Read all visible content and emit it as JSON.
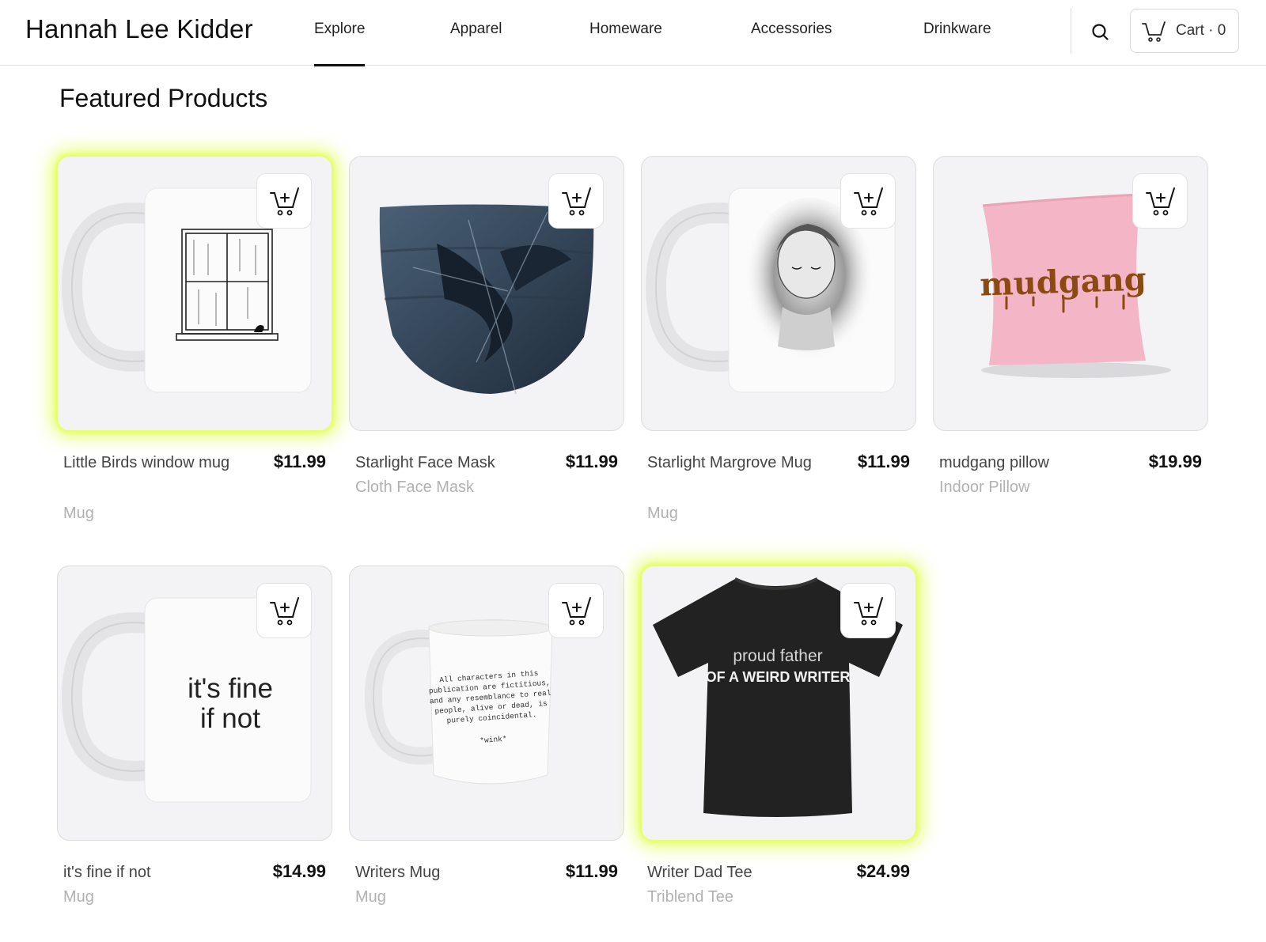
{
  "brand": {
    "name": "Hannah Lee Kidder"
  },
  "nav": {
    "items": [
      {
        "label": "Explore",
        "active": true
      },
      {
        "label": "Apparel",
        "active": false
      },
      {
        "label": "Homeware",
        "active": false
      },
      {
        "label": "Accessories",
        "active": false
      },
      {
        "label": "Drinkware",
        "active": false
      }
    ]
  },
  "header": {
    "search_icon": "search-icon",
    "cart_icon": "cart-icon",
    "cart_label": "Cart · 0"
  },
  "section": {
    "title": "Featured Products"
  },
  "colors": {
    "highlight_glow": "#d8ff1e",
    "card_bg": "#f3f3f5",
    "muted_text": "#b1b1b1"
  },
  "products": [
    {
      "name": "Little Birds window mug",
      "price": "$11.99",
      "type": "Mug",
      "highlighted": true,
      "image": "white mug with window and bird drawing"
    },
    {
      "name": "Starlight Face Mask",
      "price": "$11.99",
      "type": "Cloth Face Mask",
      "highlighted": false,
      "image": "dark blue face mask with crow"
    },
    {
      "name": "Starlight Margrove Mug",
      "price": "$11.99",
      "type": "Mug",
      "highlighted": false,
      "image": "white mug with woman portrait"
    },
    {
      "name": "mudgang pillow",
      "price": "$19.99",
      "type": "Indoor Pillow",
      "highlighted": false,
      "image": "pink pillow",
      "print_text": "mudgang"
    },
    {
      "name": "it's fine if not",
      "price": "$14.99",
      "type": "Mug",
      "highlighted": false,
      "image": "white mug with text",
      "print_text": "it's fine if not"
    },
    {
      "name": "Writers Mug",
      "price": "$11.99",
      "type": "Mug",
      "highlighted": false,
      "image": "white mug with disclaimer text",
      "print_lines": [
        "All characters in this",
        "publication are fictitious,",
        "and any resemblance to real",
        "people, alive or dead, is",
        "purely coincidental.",
        "*wink*"
      ]
    },
    {
      "name": "Writer Dad Tee",
      "price": "$24.99",
      "type": "Triblend Tee",
      "highlighted": true,
      "image": "black t-shirt",
      "print_lines": [
        "proud father",
        "OF A WEIRD WRITER"
      ]
    }
  ]
}
